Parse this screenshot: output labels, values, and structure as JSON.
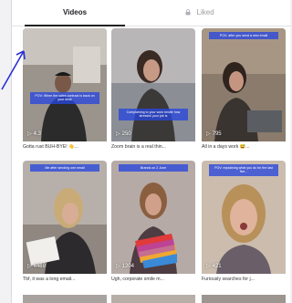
{
  "tabs": [
    {
      "label": "Videos"
    },
    {
      "label": "Liked"
    }
  ],
  "videos": [
    {
      "views": "4.3",
      "title": "Gotta rust BUH-BYE! 👋...",
      "caption": "POV: When the sales contract is back on your desk",
      "scene": "man"
    },
    {
      "views": "250",
      "title": "Zoom brain is a real thin...",
      "caption": "Complaining to your work bestie how stressful your job is",
      "scene": "woman-office"
    },
    {
      "views": "795",
      "title": "All in a days work 😅...",
      "caption": "POV: after you send a new email",
      "scene": "woman-laptop"
    },
    {
      "views": "4469",
      "title": "Tbf, it was a long email...",
      "caption": "Me after sending one email",
      "scene": "woman-blonde"
    },
    {
      "views": "1204",
      "title": "Ugh, corporate smile m...",
      "caption": "Brands on 2 June",
      "scene": "woman-rainbow"
    },
    {
      "views": "421",
      "title": "Furiously searches for j...",
      "caption": "POV: explaining what you do for the last five...",
      "scene": "woman-shocked"
    }
  ]
}
